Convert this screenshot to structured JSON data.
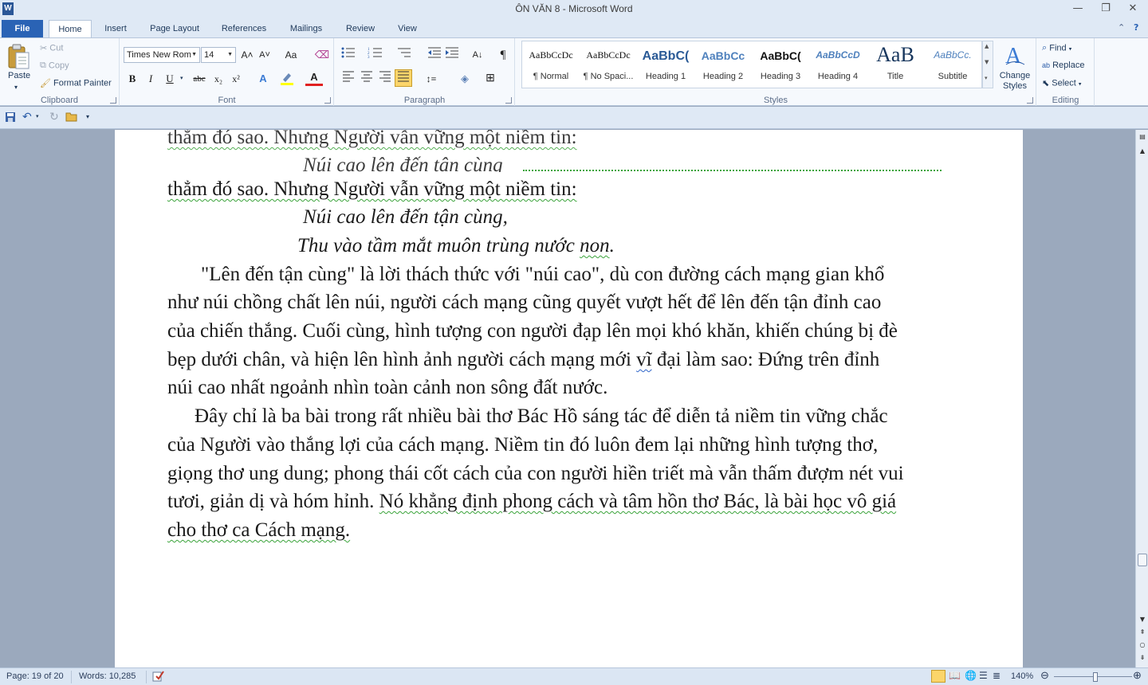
{
  "window": {
    "app_icon": "W",
    "title": "ÔN VĂN 8  -  Microsoft Word",
    "minimize_icon": "—",
    "maximize_icon": "❐",
    "close_icon": "✕"
  },
  "ribbon_tabs": {
    "file": "File",
    "home": "Home",
    "insert": "Insert",
    "page_layout": "Page Layout",
    "references": "References",
    "mailings": "Mailings",
    "review": "Review",
    "view": "View"
  },
  "clipboard": {
    "paste": "Paste",
    "cut": "Cut",
    "copy": "Copy",
    "format_painter": "Format Painter",
    "label": "Clipboard"
  },
  "font": {
    "family": "Times New Rom",
    "size": "14",
    "grow": "A˄",
    "shrink": "A˅",
    "change_case": "Aa",
    "clear": "ꭿ",
    "bold": "B",
    "italic": "I",
    "underline": "U",
    "strike": "abc",
    "subscript": "x₂",
    "superscript": "x²",
    "label": "Font"
  },
  "paragraph": {
    "label": "Paragraph",
    "pilcrow": "¶"
  },
  "styles": {
    "items": [
      {
        "sample": "AaBbCcDc",
        "name": "¶ Normal"
      },
      {
        "sample": "AaBbCcDc",
        "name": "¶ No Spaci..."
      },
      {
        "sample": "AaBbC(",
        "name": "Heading 1"
      },
      {
        "sample": "AaBbCc",
        "name": "Heading 2"
      },
      {
        "sample": "AaBbC(",
        "name": "Heading 3"
      },
      {
        "sample": "AaBbCcD",
        "name": "Heading 4"
      },
      {
        "sample": "AaB",
        "name": "Title"
      },
      {
        "sample": "AaBbCc.",
        "name": "Subtitle"
      }
    ],
    "change_styles": "Change Styles",
    "label": "Styles"
  },
  "editing": {
    "find": "Find",
    "replace": "Replace",
    "select": "Select",
    "label": "Editing"
  },
  "document": {
    "ghost_line1": "thẳm đó sao. Nhưng Người vẫn vững một niềm tin:",
    "ghost_line2": "Núi cao lên đến tận cùng",
    "line1": "thẳm đó sao. Nhưng Người vẫn vững một niềm tin:",
    "verse1": "Núi cao lên đến tận cùng,",
    "verse2_a": "Thu vào tầm mắt muôn trùng nước ",
    "verse2_b": "non",
    "verse2_c": ".",
    "p1_l1": "\"Lên đến tận cùng\" là lời thách thức với \"núi cao\", dù con đường cách mạng gian khổ",
    "p1_l2": "như núi chồng chất lên núi, người cách mạng cũng quyết vượt hết để lên đến tận đỉnh cao",
    "p1_l3": "của chiến thắng. Cuối cùng, hình tượng con người đạp lên mọi khó khăn, khiến chúng bị đè",
    "p1_l4a": "bẹp dưới chân, và hiện lên hình ảnh người cách mạng mới ",
    "p1_l4b": "vĩ",
    "p1_l4c": " đại làm sao: Đứng trên đỉnh",
    "p1_l5": "núi cao nhất ngoảnh nhìn toàn cảnh non sông đất nước.",
    "p2_l1": "Đây chỉ là ba bài trong rất nhiều bài thơ Bác Hồ sáng tác để diễn tả niềm tin vững chắc",
    "p2_l2": "của Người vào thắng lợi của cách mạng. Niềm tin đó luôn đem lại những hình tượng thơ,",
    "p2_l3": "giọng thơ ung dung; phong thái cốt cách của con người hiền triết mà vẫn thấm đượm nét vui",
    "p2_l4a": "tươi, giản dị và hóm hỉnh. ",
    "p2_l4b": "Nó khẳng định phong cách và tâm hồn thơ Bác, là bài học vô giá",
    "p2_l5": "cho thơ ca Cách mạng."
  },
  "status": {
    "page": "Page: 19 of 20",
    "words": "Words: 10,285",
    "zoom": "140%"
  },
  "colors": {
    "file_tab": "#2a63b5",
    "ribbon_bg": "#f6f9fd",
    "chrome": "#dfe9f5",
    "workspace": "#9ba9bd",
    "spell_green": "#3aa33a"
  }
}
